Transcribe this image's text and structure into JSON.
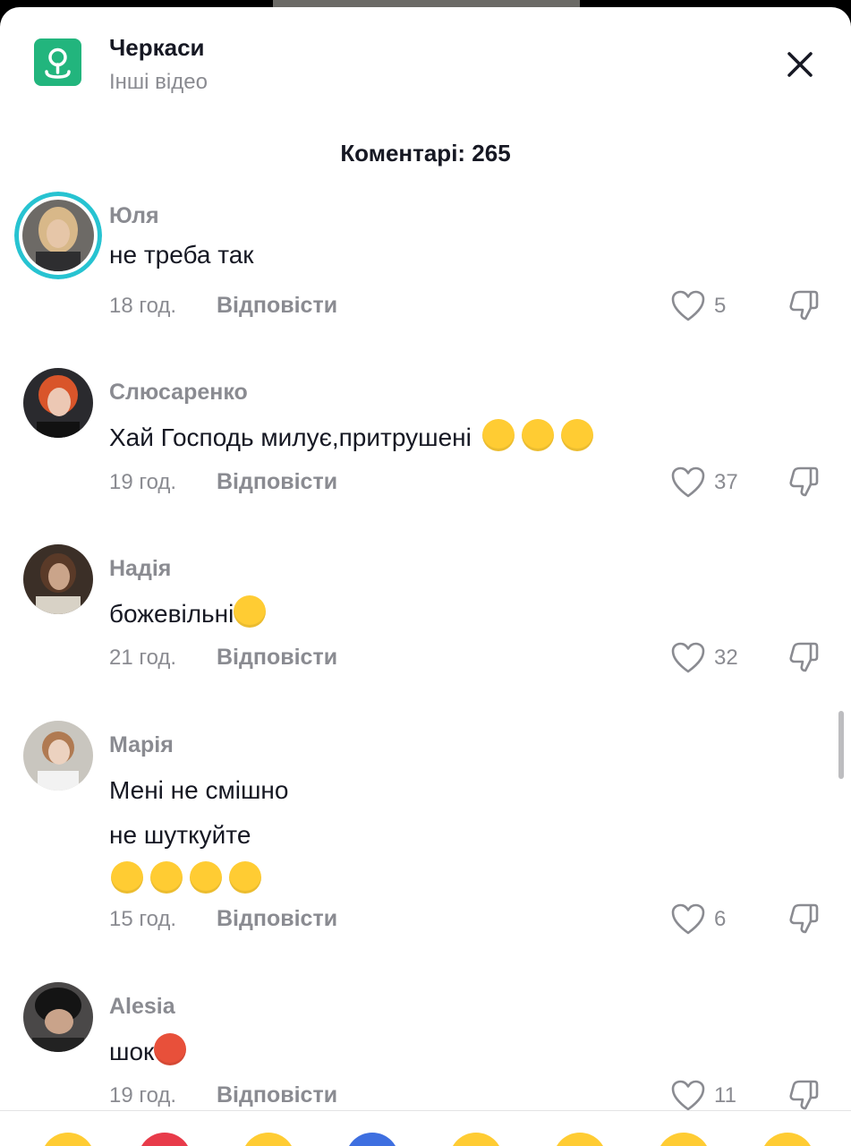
{
  "header": {
    "location_title": "Черкаси",
    "location_subtitle": "Інші відео"
  },
  "comments_header": "Коментарі: 265",
  "reply_label": "Відповісти",
  "comments": [
    {
      "user": "Юля",
      "lines": [
        "не треба так"
      ],
      "time": "18 год.",
      "likes": "5"
    },
    {
      "user": "Слюсаренко",
      "lines": [
        "Хай Господь милує,притрушені"
      ],
      "time": "19 год.",
      "likes": "37"
    },
    {
      "user": "Надія",
      "lines": [
        "божевільні"
      ],
      "time": "21 год.",
      "likes": "32"
    },
    {
      "user": "Марія",
      "lines": [
        "Мені не смішно",
        "не шуткуйте"
      ],
      "time": "15 год.",
      "likes": "6"
    },
    {
      "user": "Alesia",
      "lines": [
        "шок"
      ],
      "time": "19 год.",
      "likes": "11"
    }
  ],
  "icons": {
    "location": "location-pin-icon",
    "close": "close-icon",
    "like": "heart-icon",
    "dislike": "thumbs-down-icon"
  },
  "colors": {
    "accent_location": "#22b57d",
    "story_ring": "#27c3d1",
    "secondary_text": "#8a8b91",
    "primary_text": "#161823"
  }
}
